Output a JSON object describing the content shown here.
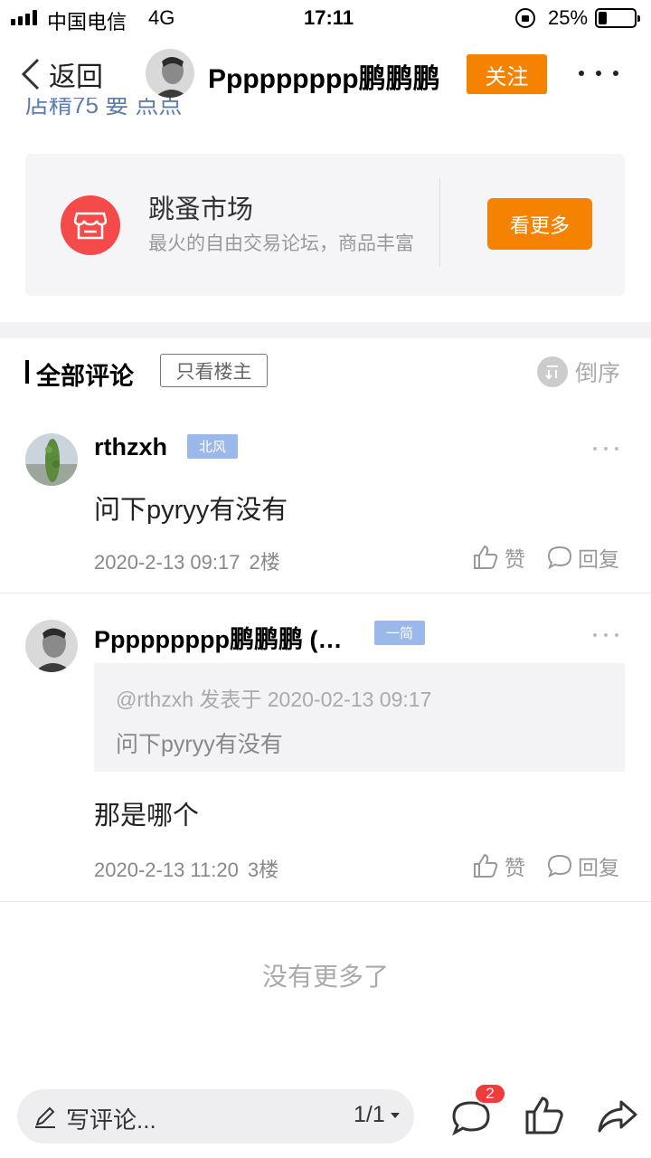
{
  "status_bar": {
    "carrier": "中国电信",
    "network": "4G",
    "time": "17:11",
    "battery": "25%"
  },
  "nav": {
    "back_label": "返回",
    "username": "Ppppppppp鹏鹏鹏",
    "follow_label": "关注"
  },
  "partial_tags": "店精75 要 点点",
  "forum": {
    "name": "跳蚤市场",
    "description": "最火的自由交易论坛，商品丰富",
    "see_more_label": "看更多"
  },
  "comments_header": {
    "title": "全部评论",
    "op_only_label": "只看楼主",
    "sort_label": "倒序"
  },
  "comments": [
    {
      "author": "rthzxh",
      "badge": "北风",
      "body": "问下pyryy有没有",
      "time": "2020-2-13 09:17",
      "floor": "2楼",
      "like_label": "赞",
      "reply_label": "回复"
    },
    {
      "author": "Ppppppppp鹏鹏鹏 (…",
      "badge": "一简",
      "quote_meta": "@rthzxh 发表于 2020-02-13 09:17",
      "quote_text": "问下pyryy有没有",
      "body": "那是哪个",
      "time": "2020-2-13 11:20",
      "floor": "3楼",
      "like_label": "赞",
      "reply_label": "回复"
    }
  ],
  "no_more_text": "没有更多了",
  "bottom_bar": {
    "placeholder": "写评论...",
    "page_indicator": "1/1",
    "comment_count": "2"
  },
  "colors": {
    "accent_orange": "#f58200",
    "forum_icon_red": "#f44a4a",
    "badge_blue": "#9ab8ea",
    "count_badge_red": "#f23c3c"
  },
  "icons": [
    "back-chevron-icon",
    "shop-icon",
    "sort-icon",
    "thumb-up-icon",
    "reply-bubble-icon",
    "pen-icon",
    "comment-bubble-icon",
    "share-arrow-icon"
  ]
}
